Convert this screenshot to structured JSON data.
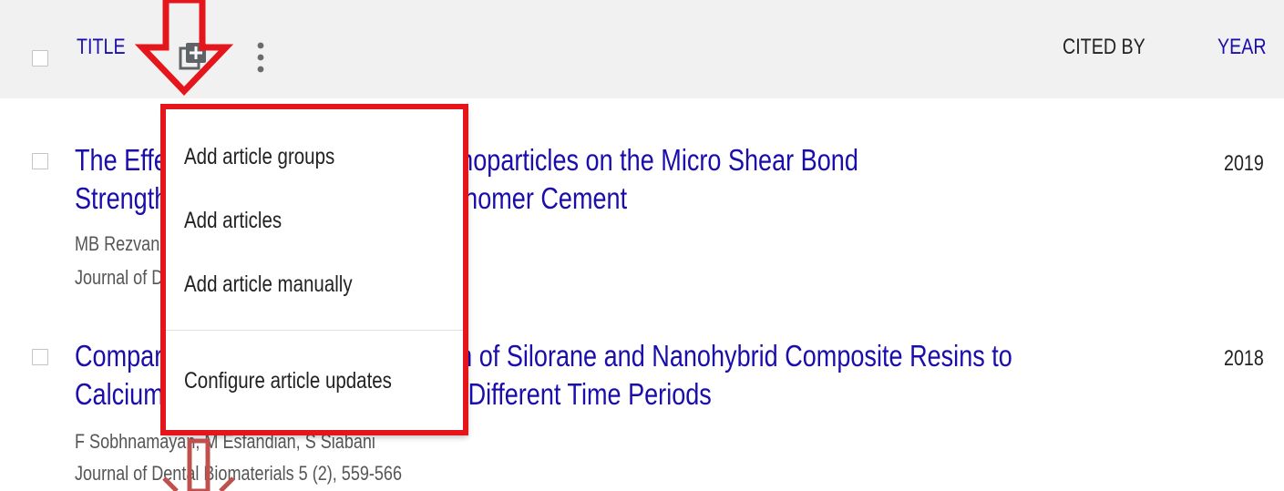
{
  "header": {
    "title_label": "TITLE",
    "cited_by_label": "CITED BY",
    "year_label": "YEAR",
    "add_icon": "library-add-icon",
    "more_icon": "more-vertical-icon"
  },
  "articles": [
    {
      "title_line1": "The Effect of Adding 1 wt. Silica Nanoparticles on the Micro Shear Bond",
      "title_line2": "Strength of Resin-Modified Glass Ionomer Cement",
      "authors": "MB Rezvani, M Atai, F Koohpeima, S Siabani",
      "journal": "Journal of Dental Biomaterials",
      "year": "2019"
    },
    {
      "title_line1": "Comparison of Shear Bond Strength of Silorane and Nanohybrid Composite Resins to",
      "title_line2": "Calcium Silicate-Based Cements at Different Time Periods",
      "authors": "F Sobhnamayan, M Esfandian, S Siabani",
      "journal": "Journal of Dental Biomaterials 5 (2), 559-566",
      "year": "2018"
    }
  ],
  "menu": {
    "items": [
      "Add article groups",
      "Add articles",
      "Add article manually",
      "Configure article updates"
    ]
  },
  "annotations": {
    "highlight_color": "#e5161b",
    "arrow_color": "#e5161b",
    "faded_arrow_color": "#c0504d"
  }
}
